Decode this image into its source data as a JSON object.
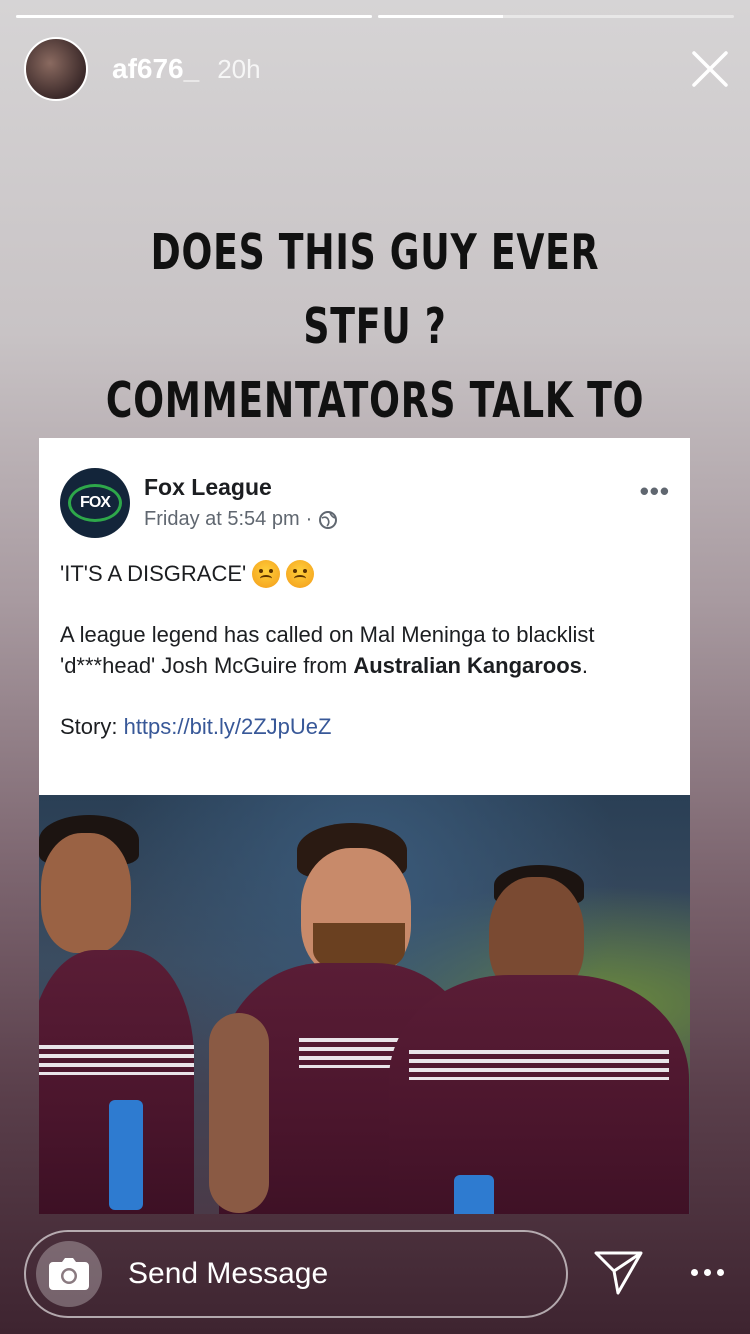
{
  "story": {
    "progress": [
      1.0,
      0.35
    ],
    "username": "af676_",
    "time": "20h",
    "caption": "DOES THIS GUY EVER STFU ?\nCOMMENTATORS TALK TO MUCH\nRUBBISH SAY IT TO HIS FACE ??"
  },
  "post": {
    "page_name": "Fox League",
    "avatar_text": "FOX",
    "meta": "Friday at 5:54 pm",
    "meta_sep": "·",
    "more": "•••",
    "headline": "'IT'S A DISGRACE'",
    "body_pre": "A league legend has called on Mal Meninga to blacklist 'd***head' Josh McGuire from ",
    "body_bold": "Australian Kangaroos",
    "body_post": ".",
    "story_label": "Story: ",
    "story_link": "https://bit.ly/2ZJpUeZ"
  },
  "footer": {
    "placeholder": "Send Message"
  },
  "icons": {
    "close": "close-icon",
    "globe": "globe-icon",
    "camera": "camera-icon",
    "send": "paper-plane-icon",
    "options": "more-options-icon"
  },
  "colors": {
    "link": "#385898",
    "fox_ring": "#2ea84a",
    "jersey": "#5a1d36"
  }
}
